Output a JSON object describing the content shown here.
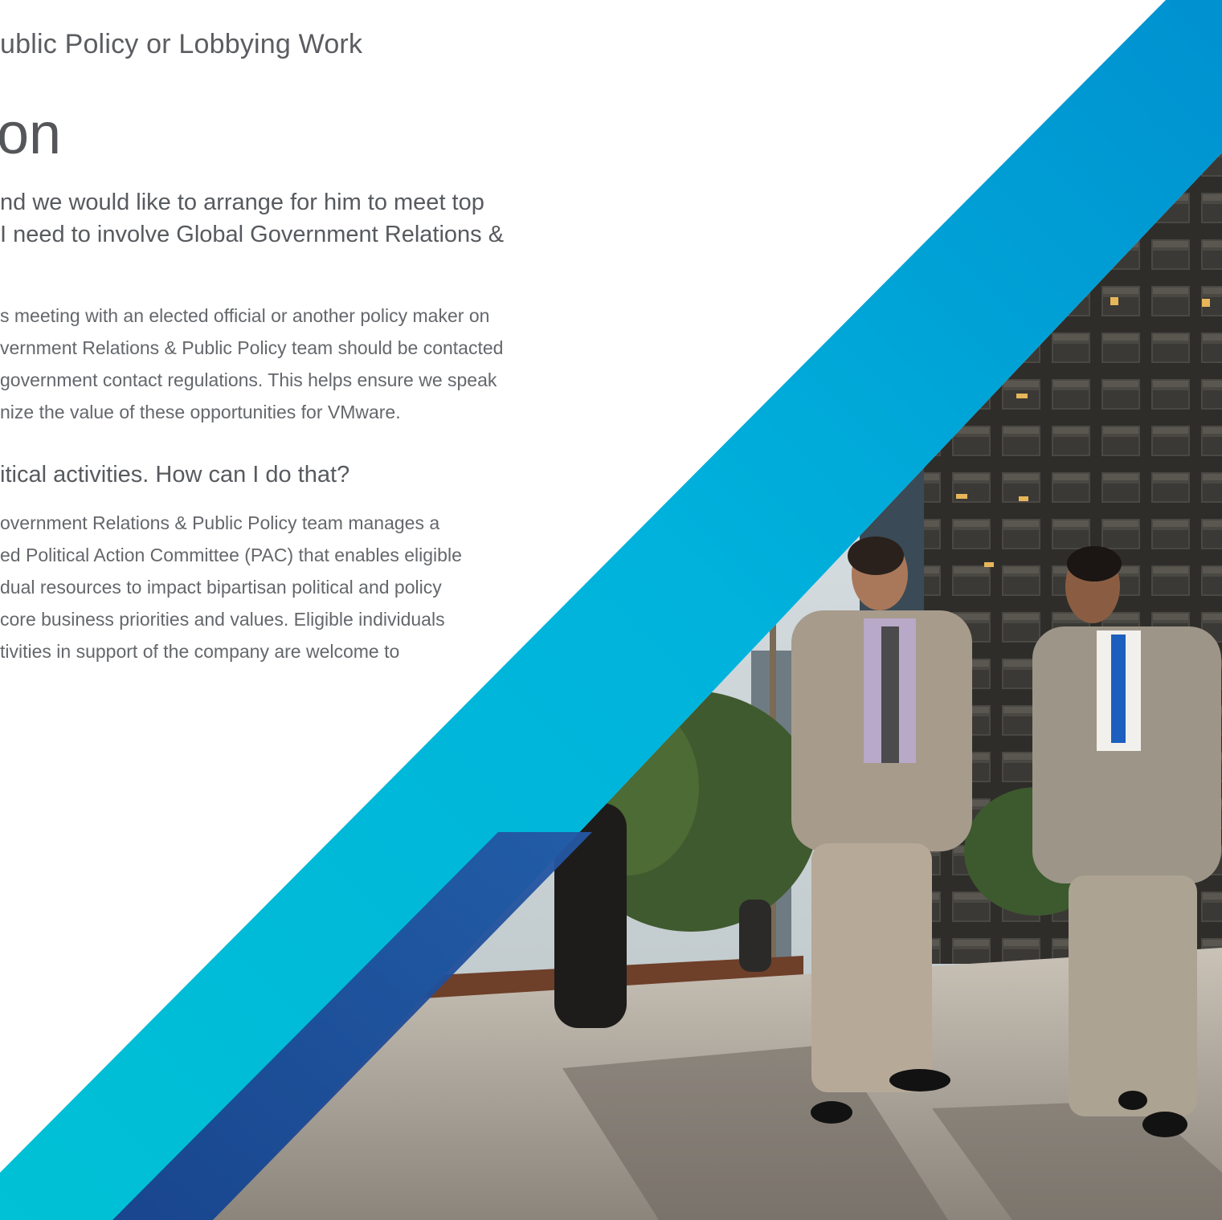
{
  "header": {
    "section_title": "ublic Policy or Lobbying Work"
  },
  "page": {
    "heading": "on"
  },
  "qa": [
    {
      "question_lines": [
        "nd we would like to arrange for him to meet top",
        "I need to involve Global Government Relations &"
      ],
      "answer_lines": [
        "s meeting with an elected official or another policy maker on",
        "vernment Relations & Public Policy team should be contacted",
        "government contact regulations. This helps ensure we speak",
        "nize the value of these opportunities for VMware."
      ]
    },
    {
      "question_lines": [
        "itical activities. How can I do that?"
      ],
      "answer_lines": [
        "overnment Relations & Public Policy team manages a",
        "ed Political Action Committee (PAC) that enables eligible",
        "dual resources to impact bipartisan political and policy",
        "core business priorities and values. Eligible individuals",
        "tivities in support of the company are welcome to"
      ]
    }
  ],
  "colors": {
    "band_light": "#00b8d9",
    "band_blue": "#0095d3",
    "band_dark": "#1d428a",
    "text": "#5b5d61"
  },
  "image": {
    "icon": "business-people-walking-photo"
  }
}
